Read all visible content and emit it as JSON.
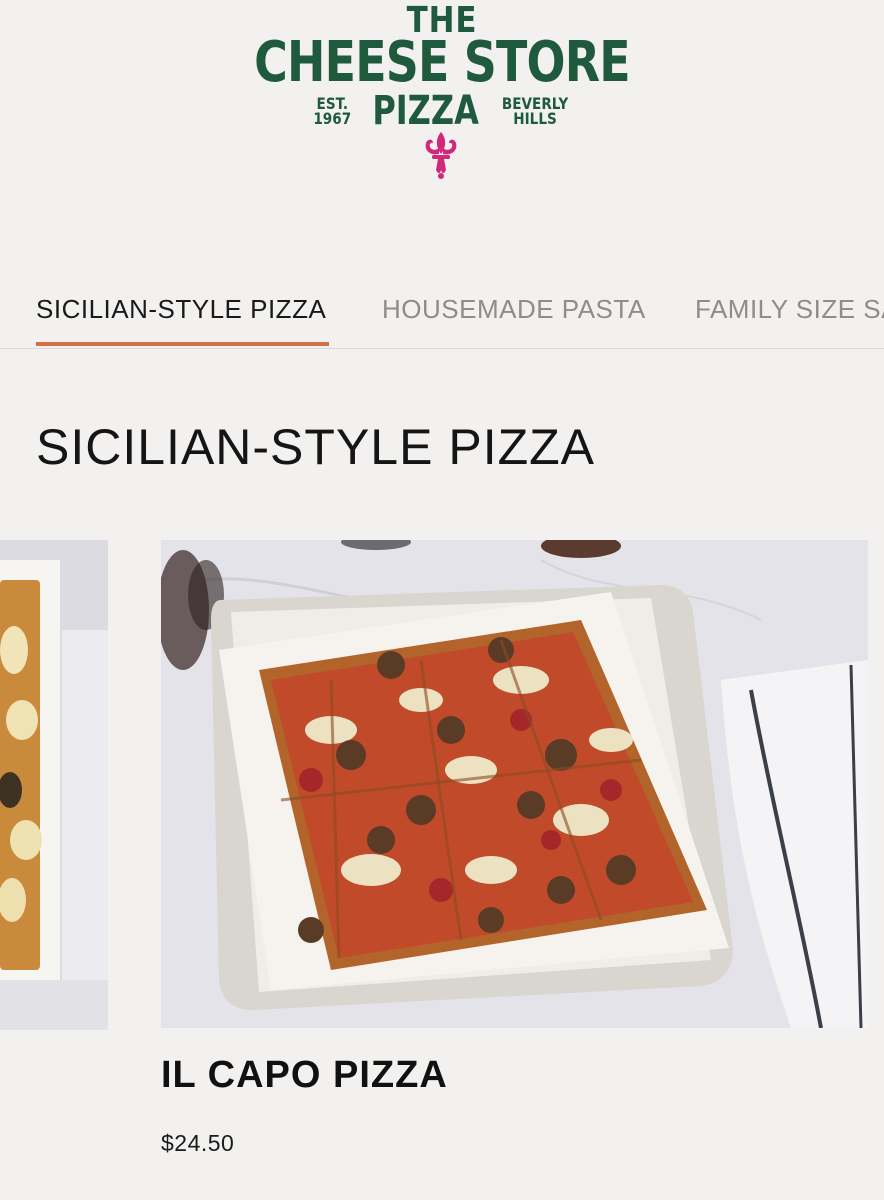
{
  "logo": {
    "line_the": "THE",
    "line_name": "CHEESE STORE",
    "est_line1": "EST.",
    "est_line2": "1967",
    "line_pizza": "PIZZA",
    "loc_line1": "BEVERLY",
    "loc_line2": "HILLS",
    "icon": "fleur-de-lis-icon",
    "brand_color": "#1f5a3e",
    "accent_color": "#d0287a"
  },
  "tabs": [
    {
      "label": "SICILIAN-STYLE PIZZA",
      "active": true
    },
    {
      "label": "HOUSEMADE PASTA",
      "active": false
    },
    {
      "label": "FAMILY SIZE SA",
      "active": false
    }
  ],
  "tab_underline_color": "#d2704a",
  "section": {
    "title": "SICILIAN-STYLE PIZZA"
  },
  "products": [
    {
      "name": "IL CAPO PIZZA",
      "price": "$24.50",
      "image": "pizza-photo"
    }
  ]
}
